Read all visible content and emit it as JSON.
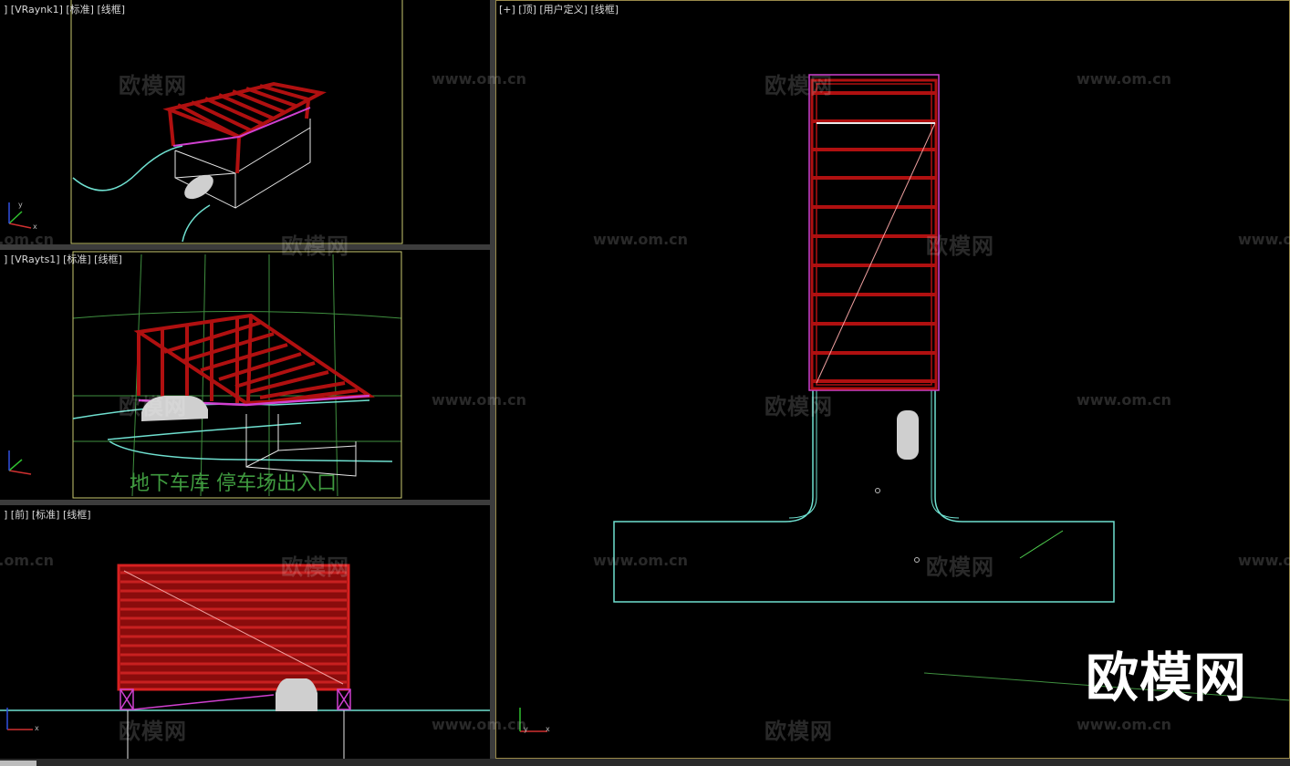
{
  "viewports": {
    "camera_top": {
      "label": "] [VRaynk1] [标准] [线框]"
    },
    "camera_mid": {
      "label": "] [VRayts1] [标准] [线框]",
      "caption": "地下车库 停车场出入口"
    },
    "front": {
      "label": "] [前] [标准] [线框]"
    },
    "top": {
      "label": "[+] [顶] [用户定义] [线框]"
    }
  },
  "axis": {
    "x": "x",
    "y": "y",
    "z": "z"
  },
  "watermark": {
    "cn": "欧模网",
    "url": "www.om.cn"
  },
  "brand": "欧模网",
  "colors": {
    "frame_red": "#b01010",
    "outline_cyan": "#6fe0d0",
    "magenta": "#d040d0",
    "safe_frame_yellow": "#c8c870",
    "grid_green": "#3f8f3f",
    "car_gray": "#cfcfcf",
    "label_text": "#d8d8d8",
    "active_border": "#9a8a4a"
  }
}
